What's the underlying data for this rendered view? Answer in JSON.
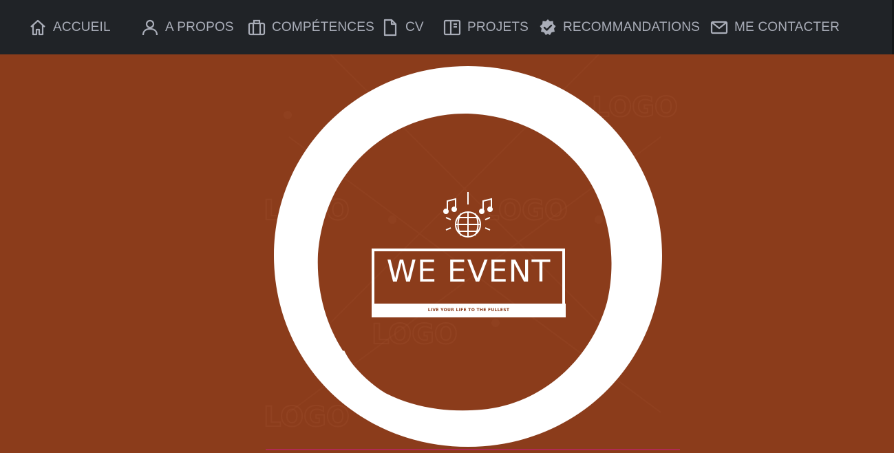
{
  "nav": {
    "items": [
      {
        "label": "ACCUEIL",
        "icon": "home-icon"
      },
      {
        "label": "A PROPOS",
        "icon": "user-icon"
      },
      {
        "label": "COMPÉTENCES",
        "icon": "briefcase-icon"
      },
      {
        "label": "CV",
        "icon": "document-icon"
      },
      {
        "label": "PROJETS",
        "icon": "columns-icon"
      },
      {
        "label": "RECOMMANDATIONS",
        "icon": "verified-badge-icon"
      },
      {
        "label": "ME CONTACTER",
        "icon": "mail-icon"
      }
    ]
  },
  "hero": {
    "brand": "WE EVENT",
    "tagline": "LIVE YOUR LIFE TO THE FULLEST",
    "logo_icon": "disco-ball-icon",
    "watermark_text": "LOGO"
  },
  "colors": {
    "navbar_bg": "#202327",
    "nav_text": "#a9adb8",
    "hero_bg": "#8b3c1b",
    "logo_white": "#ffffff",
    "accent_line": "#b02a52"
  }
}
